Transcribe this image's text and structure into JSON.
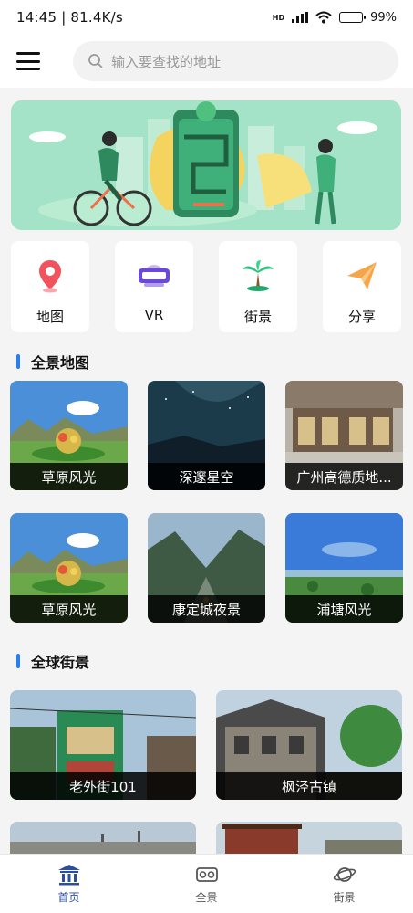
{
  "status_bar": {
    "time_speed": "14:45 | 81.4K/s",
    "network": "HD",
    "battery": "99%"
  },
  "top_bar": {
    "search_placeholder": "输入要查找的地址"
  },
  "quick_actions": [
    {
      "label": "地图",
      "icon": "map-pin-icon"
    },
    {
      "label": "VR",
      "icon": "vr-headset-icon"
    },
    {
      "label": "街景",
      "icon": "palm-tree-icon"
    },
    {
      "label": "分享",
      "icon": "paper-plane-icon"
    }
  ],
  "panorama_section": {
    "title": "全景地图",
    "items": [
      {
        "label": "草原风光"
      },
      {
        "label": "深邃星空"
      },
      {
        "label": "广州高德质地..."
      },
      {
        "label": "草原风光"
      },
      {
        "label": "康定城夜景"
      },
      {
        "label": "浦塘风光"
      }
    ]
  },
  "street_section": {
    "title": "全球街景",
    "items": [
      {
        "label": "老外街101"
      },
      {
        "label": "枫泾古镇"
      }
    ]
  },
  "bottom_nav": [
    {
      "label": "首页",
      "active": true
    },
    {
      "label": "全景",
      "active": false
    },
    {
      "label": "街景",
      "active": false
    }
  ],
  "colors": {
    "accent": "#2b7de9",
    "nav_active": "#2b4f9e",
    "banner_bg": "#9ee0c4"
  }
}
